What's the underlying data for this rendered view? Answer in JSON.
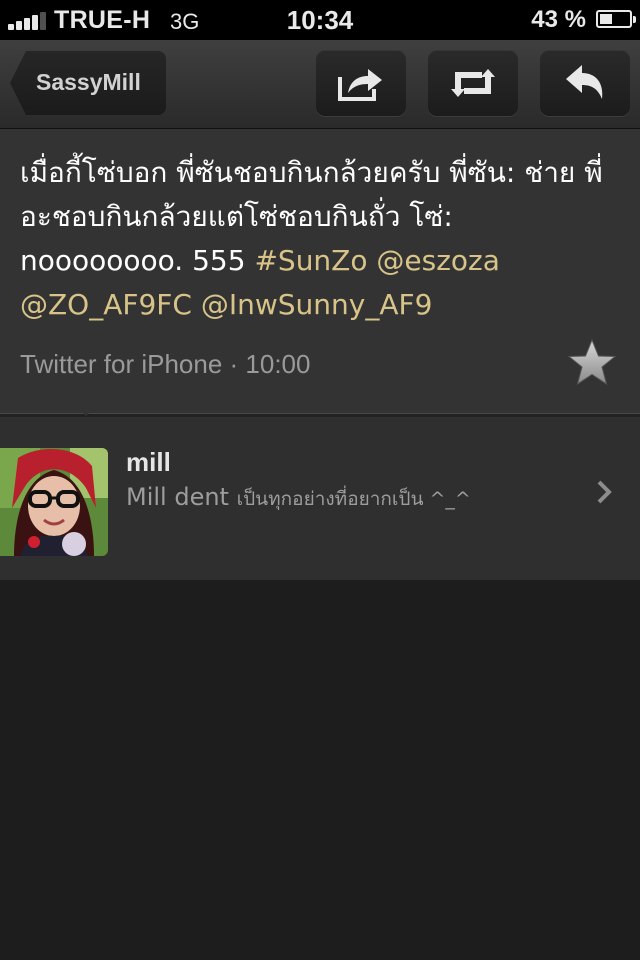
{
  "status_bar": {
    "carrier": "TRUE-H",
    "network": "3G",
    "time": "10:34",
    "battery_percent": "43 %",
    "battery_level": 0.43
  },
  "nav": {
    "back_label": "SassyMill",
    "icons": [
      "share-icon",
      "retweet-icon",
      "reply-icon"
    ]
  },
  "tweet": {
    "text_plain": "เมื่อกี้โซ่บอก พี่ซันชอบกินกล้วยครับ พี่ซัน: ช่าย พี่อะชอบกินกล้วยแต่โซ่ชอบกินถั่ว โซ่: noooooooo. 555 ",
    "hashtag": "#SunZo",
    "mention_1": "@eszoza",
    "mention_2": "@ZO_AF9FC",
    "mention_3": "@InwSunny_AF9",
    "source_time": "Twitter for iPhone · 10:00",
    "favorite_icon": "star-icon"
  },
  "user": {
    "name": "mill",
    "bio_name": "Mill dent",
    "bio_text": "เป็นทุกอย่างที่อยากเป็น ^_^",
    "chevron_icon": "chevron-right-icon"
  },
  "colors": {
    "highlight": "#d8c488",
    "background": "#1d1d1d",
    "tweet_bg": "#333333"
  }
}
